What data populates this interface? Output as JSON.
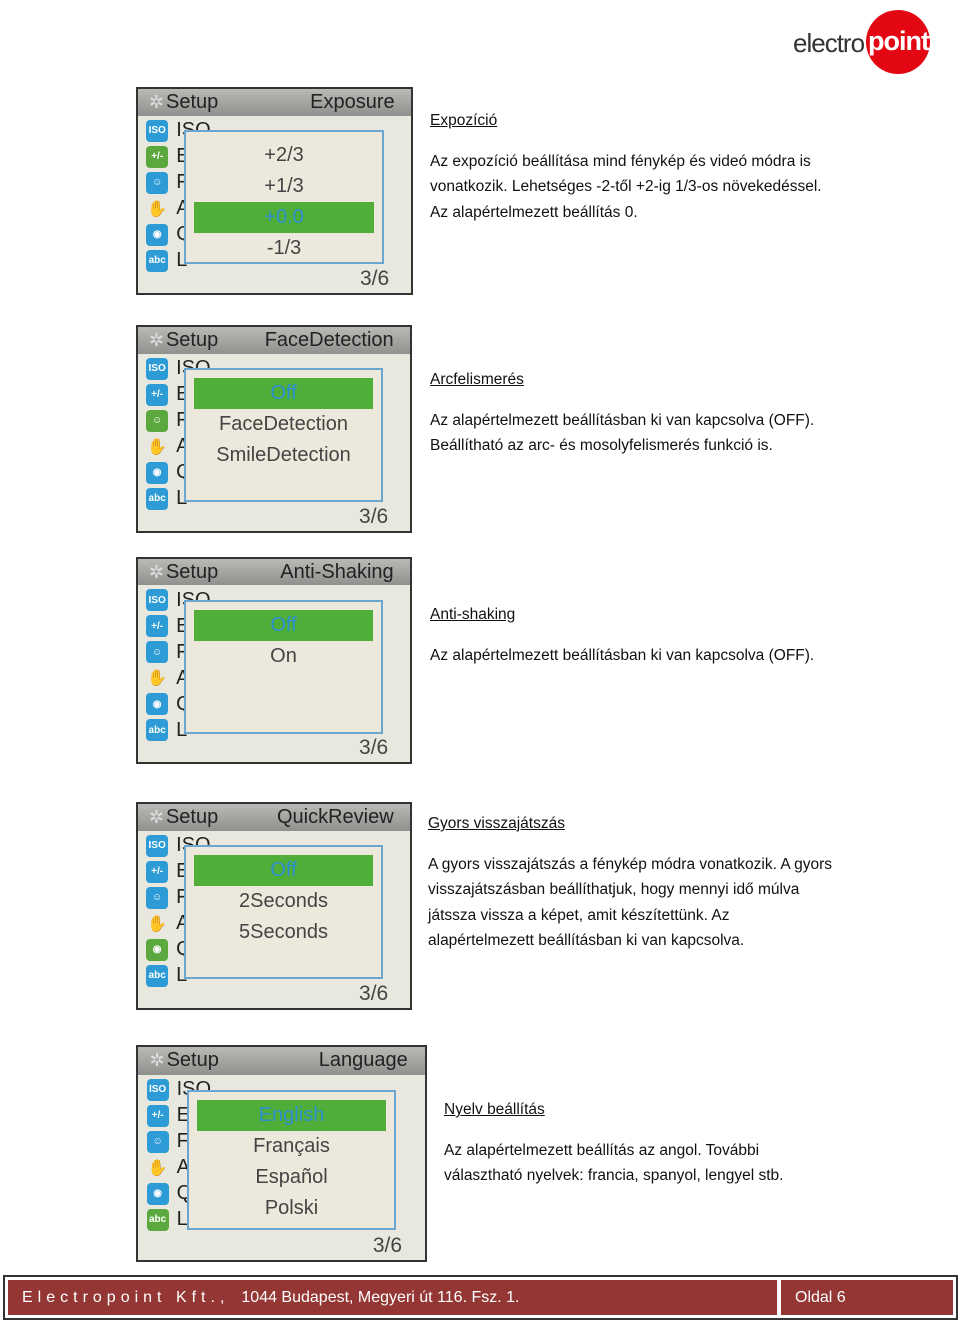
{
  "logo": {
    "text_light": "electro",
    "text_bold": "point",
    "color": "#e30613"
  },
  "menu_items": [
    {
      "icon": "iso-icon",
      "glyph": "ISO",
      "label": "ISO"
    },
    {
      "icon": "exposure-icon",
      "glyph": "+/-",
      "label": "E"
    },
    {
      "icon": "face-icon",
      "glyph": "☺",
      "label": "F"
    },
    {
      "icon": "hand-shake-icon",
      "glyph": "✋",
      "label": "A"
    },
    {
      "icon": "quick-review-icon",
      "glyph": "◉",
      "label": "Q"
    },
    {
      "icon": "language-icon",
      "glyph": "abc",
      "label": "L"
    }
  ],
  "sections": [
    {
      "screen": {
        "setup": "Setup",
        "title": "Exposure",
        "options": [
          "+2/3",
          "+1/3",
          "+0.0",
          "-1/3"
        ],
        "selected": 2,
        "active_menu": 1,
        "page": "3/6"
      },
      "heading": "Expozíció",
      "lines": [
        "Az expozíció beállítása mind fénykép és videó módra is",
        "vonatkozik. Lehetséges -2-től +2-ig 1/3-os növekedéssel.",
        "Az alapértelmezett beállítás 0."
      ]
    },
    {
      "screen": {
        "setup": "Setup",
        "title": "FaceDetection",
        "options": [
          "Off",
          "FaceDetection",
          "SmileDetection"
        ],
        "selected": 0,
        "active_menu": 2,
        "page": "3/6"
      },
      "heading": "Arcfelismerés",
      "lines": [
        "Az alapértelmezett beállításban ki van kapcsolva (OFF).",
        "Beállítható az arc- és mosolyfelismerés funkció is."
      ]
    },
    {
      "screen": {
        "setup": "Setup",
        "title": "Anti-Shaking",
        "options": [
          "Off",
          "On"
        ],
        "selected": 0,
        "active_menu": 3,
        "page": "3/6"
      },
      "heading": "Anti-shaking",
      "lines": [
        "Az alapértelmezett beállításban ki van kapcsolva (OFF)."
      ]
    },
    {
      "screen": {
        "setup": "Setup",
        "title": "QuickReview",
        "options": [
          "Off",
          "2Seconds",
          "5Seconds"
        ],
        "selected": 0,
        "active_menu": 4,
        "page": "3/6"
      },
      "heading": "Gyors  visszajátszás",
      "lines": [
        "A gyors visszajátszás a fénykép módra vonatkozik. A gyors",
        "visszajátszásban beállíthatjuk, hogy mennyi idő múlva",
        "játssza vissza a képet, amit készítettünk.  Az",
        "alapértelmezett beállításban ki van kapcsolva."
      ]
    },
    {
      "screen": {
        "setup": "Setup",
        "title": "Language",
        "options": [
          "English",
          "Français",
          "Español",
          "Polski"
        ],
        "selected": 0,
        "active_menu": 5,
        "page": "3/6"
      },
      "heading": "Nyelv beállítás",
      "lines": [
        "Az alapértelmezett beállítás az angol. További",
        "választható nyelvek: francia, spanyol, lengyel stb."
      ]
    }
  ],
  "footer": {
    "company": "Electropoint Kft.,",
    "address": "1044 Budapest, Megyeri út 116. Fsz. 1.",
    "page": "Oldal 6",
    "color": "#943634"
  }
}
